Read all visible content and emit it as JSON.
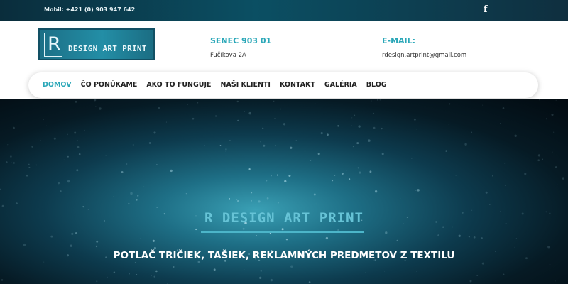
{
  "topbar": {
    "phone": "Mobil: +421 (0) 903 947 642",
    "social_icon": "facebook-icon",
    "social_glyph": "f"
  },
  "header": {
    "logo_letter": "R",
    "logo_text": "DESIGN ART PRINT",
    "city_title": "SENEC 903 01",
    "street": "Fučíkova 2A",
    "email_title": "E-MAIL:",
    "email": "rdesign.artprint@gmail.com"
  },
  "nav": {
    "items": [
      {
        "label": "DOMOV",
        "active": true
      },
      {
        "label": "ČO PONÚKAME",
        "active": false
      },
      {
        "label": "AKO TO FUNGUJE",
        "active": false
      },
      {
        "label": "NAŠI KLIENTI",
        "active": false
      },
      {
        "label": "KONTAKT",
        "active": false
      },
      {
        "label": "GALÉRIA",
        "active": false
      },
      {
        "label": "BLOG",
        "active": false
      }
    ]
  },
  "hero": {
    "title": "R DESIGN ART PRINT",
    "subtitle": "POTLAČ TRIČIEK, TAŠIEK, REKLAMNÝCH PREDMETOV Z TEXTILU"
  },
  "colors": {
    "accent": "#2aa7b8",
    "topbar": "#0b4f63",
    "logo_bg": "#238ea6"
  }
}
